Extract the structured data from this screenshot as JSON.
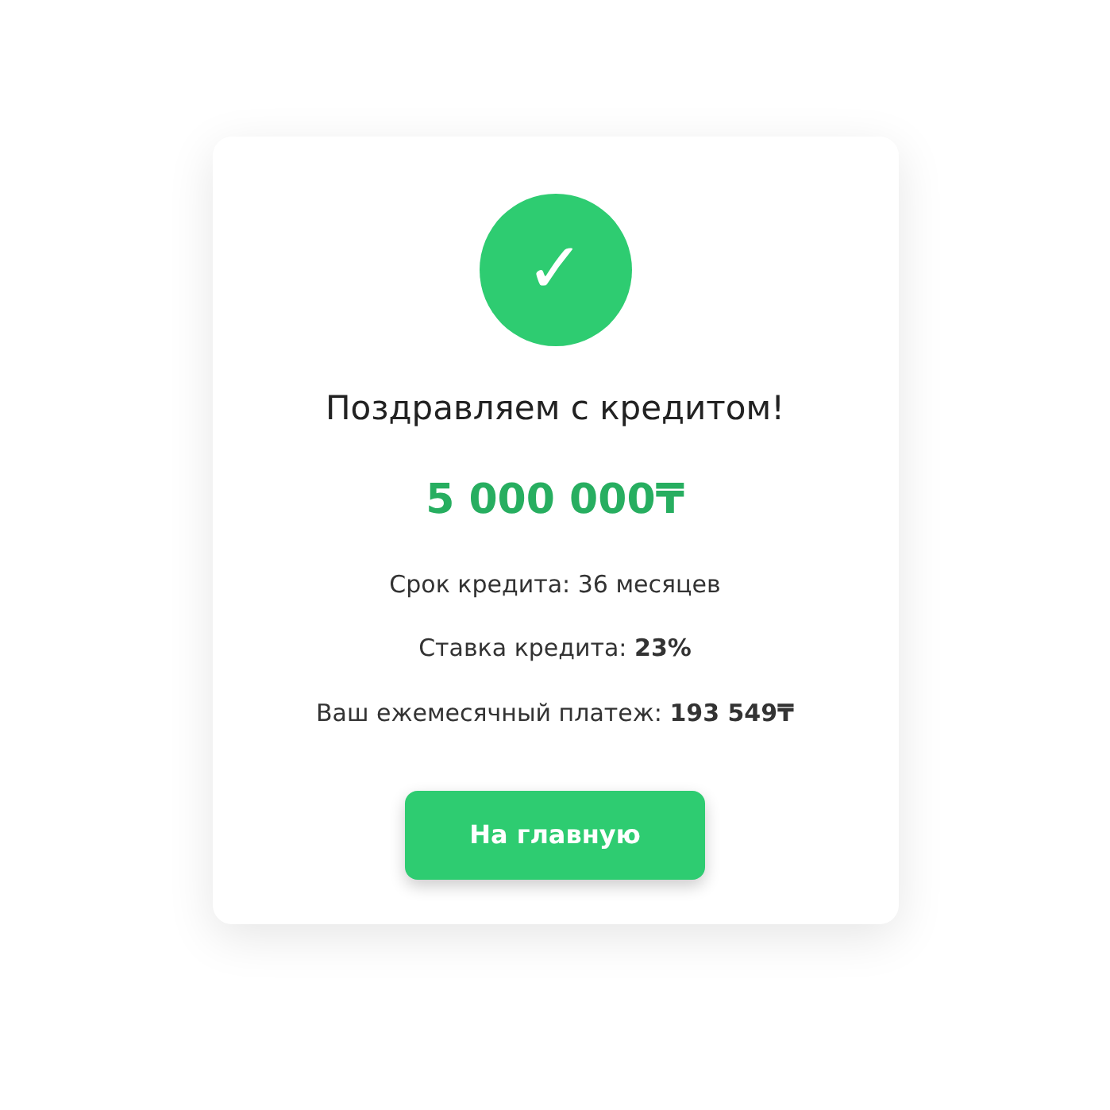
{
  "success_icon": {
    "symbol": "✓"
  },
  "title": "Поздравляем с кредитом!",
  "amount": "5 000 000₸",
  "details": [
    "Срок кредита: 36 месяцев",
    "Ставка кредита: **23%**",
    "Ваш ежемесячный платеж: **193 549₸**"
  ],
  "button": "На главную"
}
